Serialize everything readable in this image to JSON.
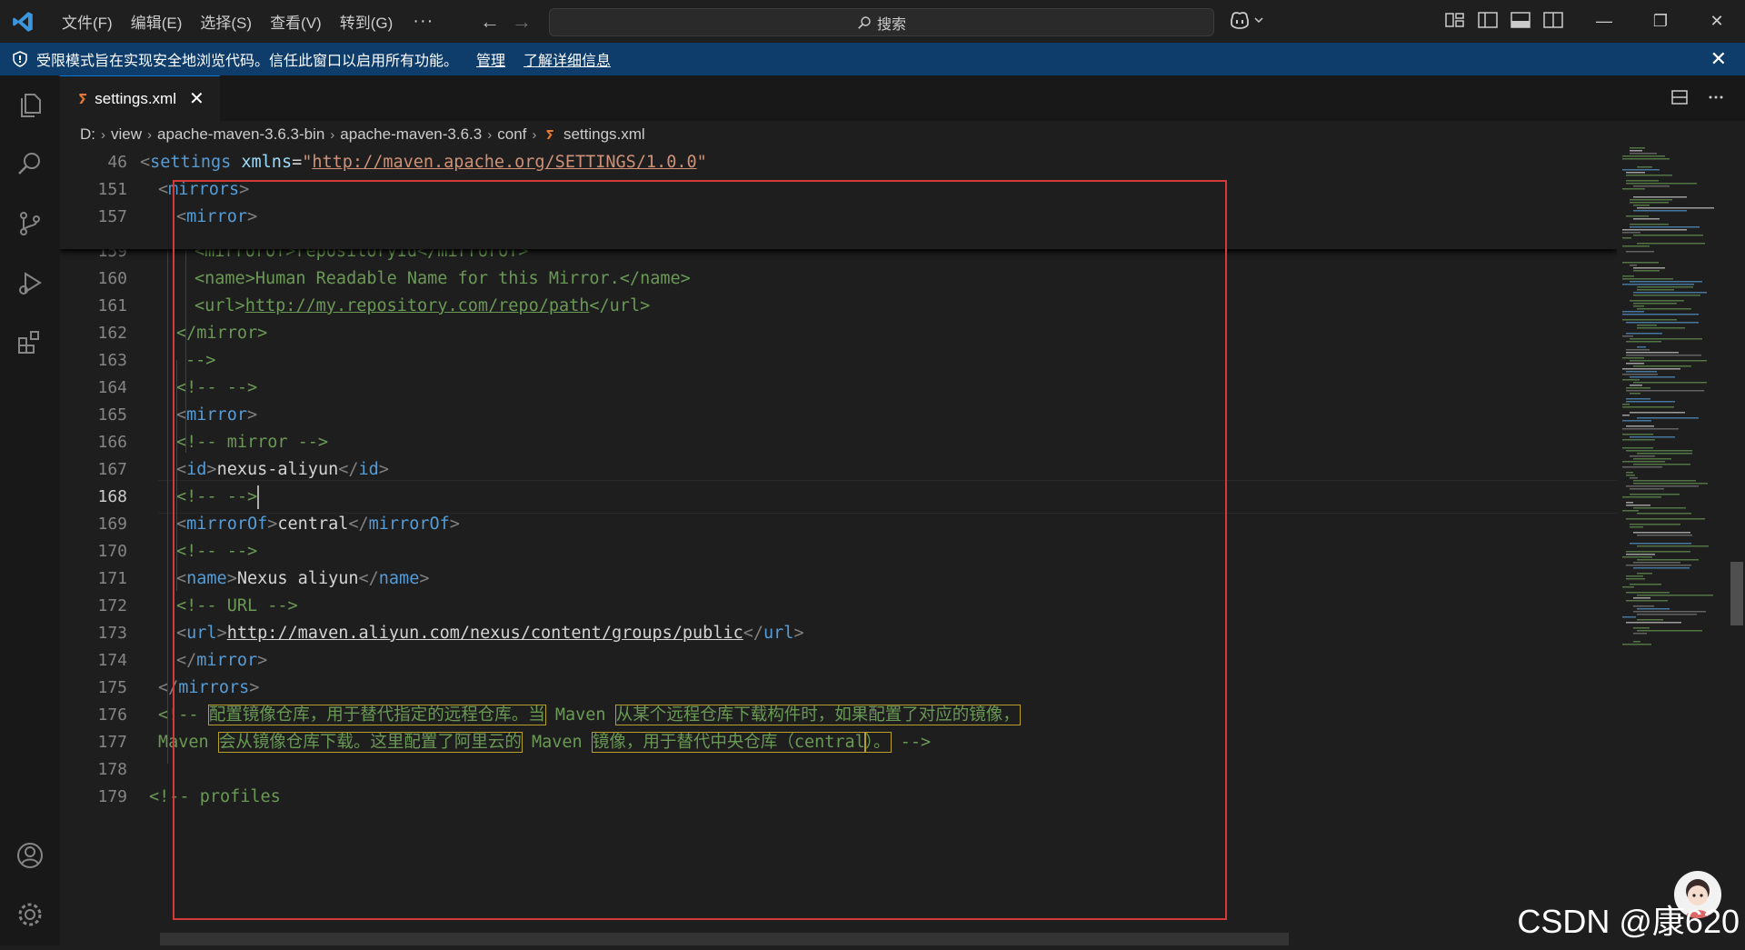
{
  "titlebar": {
    "menu": [
      "文件(F)",
      "编辑(E)",
      "选择(S)",
      "查看(V)",
      "转到(G)"
    ],
    "more": "···",
    "back": "←",
    "forward": "→",
    "search_placeholder": "搜索",
    "minimize": "—",
    "restore": "❐",
    "close": "✕"
  },
  "banner": {
    "message": "受限模式旨在实现安全地浏览代码。信任此窗口以启用所有功能。",
    "manage": "管理",
    "learn_more": "了解详细信息",
    "close": "✕"
  },
  "tab": {
    "label": "settings.xml",
    "close": "✕",
    "icon": "rss-xml-icon"
  },
  "breadcrumb": {
    "items": [
      "D:",
      "view",
      "apache-maven-3.6.3-bin",
      "apache-maven-3.6.3",
      "conf"
    ],
    "file": "settings.xml",
    "sep": "›"
  },
  "editor": {
    "active_line": "168",
    "lines": [
      {
        "n": "46",
        "indent": 0,
        "tokens": [
          [
            "t",
            "<"
          ],
          [
            "n",
            "settings"
          ],
          [
            "x",
            " "
          ],
          [
            "a",
            "xmlns"
          ],
          [
            "x",
            "="
          ],
          [
            "s",
            "\""
          ],
          [
            "su",
            "http://maven.apache.org/SETTINGS/1.0.0"
          ],
          [
            "s",
            "\""
          ]
        ]
      },
      {
        "n": "151",
        "indent": 1,
        "tokens": [
          [
            "t",
            "<"
          ],
          [
            "n",
            "mirrors"
          ],
          [
            "t",
            ">"
          ]
        ]
      },
      {
        "n": "157",
        "indent": 2,
        "tokens": [
          [
            "t",
            "<"
          ],
          [
            "n",
            "mirror"
          ],
          [
            "t",
            ">"
          ]
        ]
      },
      {
        "n": "159",
        "indent": 3,
        "tokens": [
          [
            "c",
            "<mirrorOf>repositoryId</mirrorOf>"
          ]
        ]
      },
      {
        "n": "160",
        "indent": 3,
        "tokens": [
          [
            "c",
            "<name>Human Readable Name for this Mirror.</name>"
          ]
        ]
      },
      {
        "n": "161",
        "indent": 3,
        "tokens": [
          [
            "c",
            "<url>"
          ],
          [
            "cu",
            "http://my.repository.com/repo/path"
          ],
          [
            "c",
            "</url>"
          ]
        ]
      },
      {
        "n": "162",
        "indent": 2,
        "tokens": [
          [
            "c",
            "</mirror>"
          ]
        ]
      },
      {
        "n": "163",
        "indent": 2.5,
        "tokens": [
          [
            "c",
            "-->"
          ]
        ]
      },
      {
        "n": "164",
        "indent": 2,
        "tokens": [
          [
            "c",
            "<!-- -->"
          ]
        ]
      },
      {
        "n": "165",
        "indent": 2,
        "tokens": [
          [
            "t",
            "<"
          ],
          [
            "n",
            "mirror"
          ],
          [
            "t",
            ">"
          ]
        ]
      },
      {
        "n": "166",
        "indent": 2,
        "tokens": [
          [
            "c",
            "<!-- mirror -->"
          ]
        ]
      },
      {
        "n": "167",
        "indent": 2,
        "tokens": [
          [
            "t",
            "<"
          ],
          [
            "n",
            "id"
          ],
          [
            "t",
            ">"
          ],
          [
            "x",
            "nexus-aliyun"
          ],
          [
            "t",
            "</"
          ],
          [
            "n",
            "id"
          ],
          [
            "t",
            ">"
          ]
        ]
      },
      {
        "n": "168",
        "indent": 2,
        "tokens": [
          [
            "c",
            "<!-- -->"
          ],
          [
            "cursor",
            ""
          ]
        ]
      },
      {
        "n": "169",
        "indent": 2,
        "tokens": [
          [
            "t",
            "<"
          ],
          [
            "n",
            "mirrorOf"
          ],
          [
            "t",
            ">"
          ],
          [
            "x",
            "central"
          ],
          [
            "t",
            "</"
          ],
          [
            "n",
            "mirrorOf"
          ],
          [
            "t",
            ">"
          ]
        ]
      },
      {
        "n": "170",
        "indent": 2,
        "tokens": [
          [
            "c",
            "<!-- -->"
          ]
        ]
      },
      {
        "n": "171",
        "indent": 2,
        "tokens": [
          [
            "t",
            "<"
          ],
          [
            "n",
            "name"
          ],
          [
            "t",
            ">"
          ],
          [
            "x",
            "Nexus aliyun"
          ],
          [
            "t",
            "</"
          ],
          [
            "n",
            "name"
          ],
          [
            "t",
            ">"
          ]
        ]
      },
      {
        "n": "172",
        "indent": 2,
        "tokens": [
          [
            "c",
            "<!-- URL -->"
          ]
        ]
      },
      {
        "n": "173",
        "indent": 2,
        "tokens": [
          [
            "t",
            "<"
          ],
          [
            "n",
            "url"
          ],
          [
            "t",
            ">"
          ],
          [
            "xu",
            "http://maven.aliyun.com/nexus/content/groups/public"
          ],
          [
            "t",
            "</"
          ],
          [
            "n",
            "url"
          ],
          [
            "t",
            ">"
          ]
        ]
      },
      {
        "n": "174",
        "indent": 2,
        "tokens": [
          [
            "t",
            "</"
          ],
          [
            "n",
            "mirror"
          ],
          [
            "t",
            ">"
          ]
        ]
      },
      {
        "n": "175",
        "indent": 1,
        "tokens": [
          [
            "t",
            "</"
          ],
          [
            "n",
            "mirrors"
          ],
          [
            "t",
            ">"
          ]
        ]
      },
      {
        "n": "176",
        "indent": 1,
        "tokens": [
          [
            "c",
            "<!-- "
          ],
          [
            "ch",
            "配置镜像仓库，用于替代指定的远程仓库。当"
          ],
          [
            "c",
            " Maven "
          ],
          [
            "ch",
            "从某个远程仓库下载构件时，如果配置了对应的镜像，"
          ]
        ]
      },
      {
        "n": "177",
        "indent": 1,
        "tokens": [
          [
            "c",
            "Maven "
          ],
          [
            "ch",
            "会从镜像仓库下载。这里配置了阿里云的"
          ],
          [
            "c",
            " Maven "
          ],
          [
            "ch",
            "镜像，用于替代中央仓库（central"
          ],
          [
            "ch",
            "）。"
          ],
          [
            "c",
            " -->"
          ]
        ]
      },
      {
        "n": "178",
        "indent": 0,
        "tokens": []
      },
      {
        "n": "179",
        "indent": 0.5,
        "tokens": [
          [
            "c",
            "<!-- profiles"
          ]
        ]
      }
    ]
  },
  "watermark": "CSDN @康620"
}
